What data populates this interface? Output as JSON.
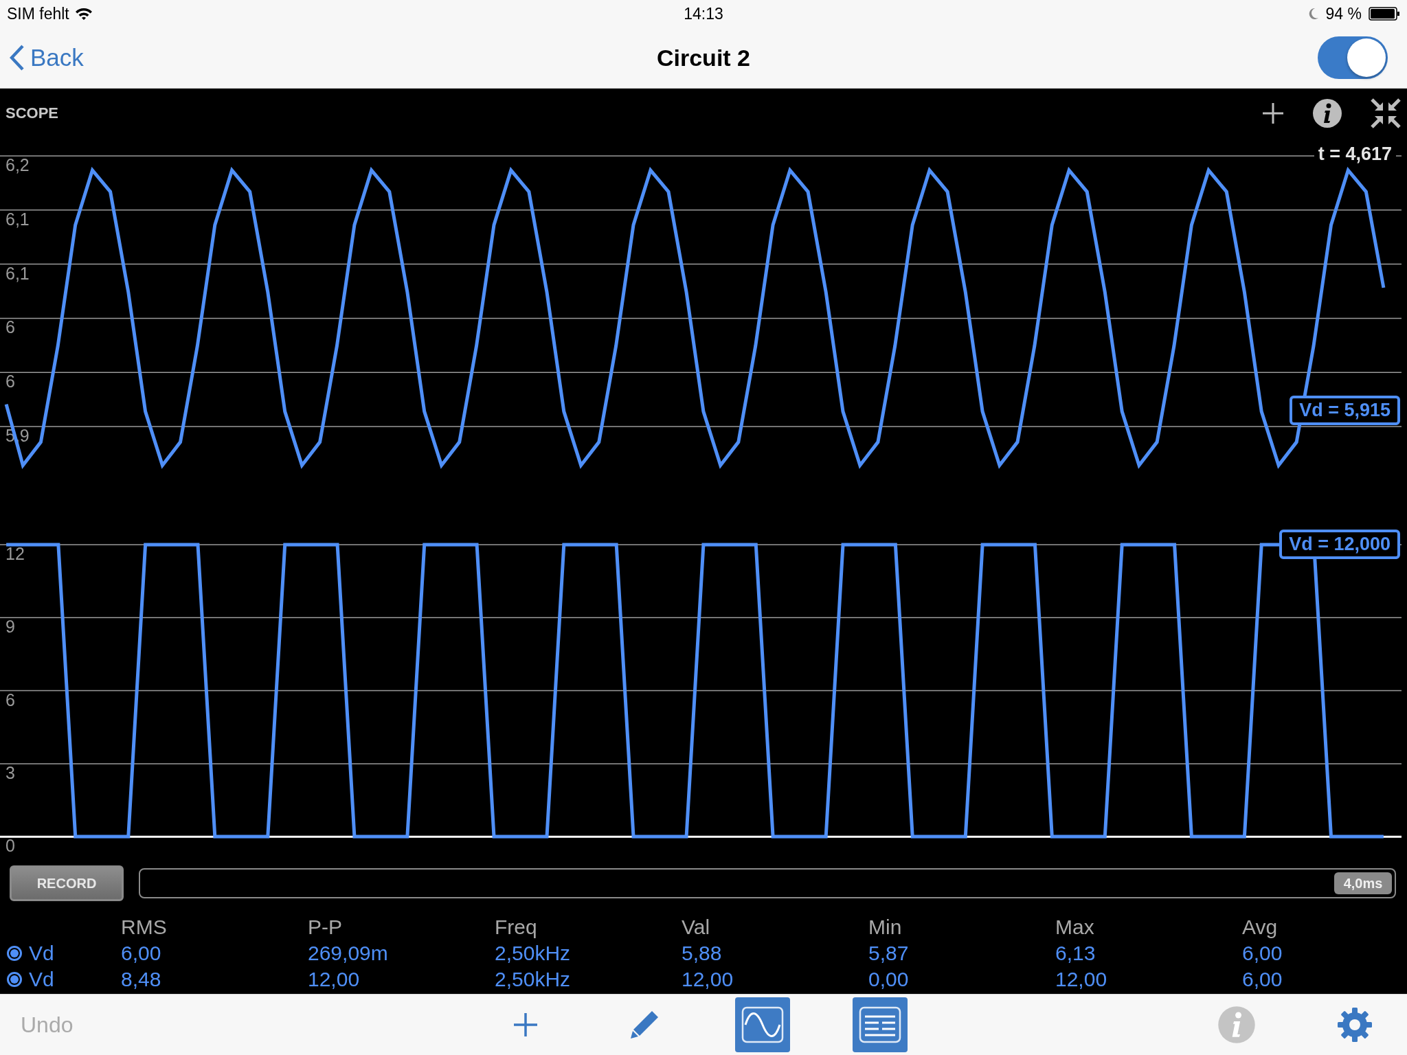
{
  "status_bar": {
    "carrier": "SIM fehlt",
    "time": "14:13",
    "battery": "94 %"
  },
  "nav": {
    "back": "Back",
    "title": "Circuit 2",
    "toggle": {
      "on": true
    }
  },
  "scope": {
    "title": "SCOPE",
    "cursor_time": "t = 4,617",
    "charts": [
      {
        "kind": "sine",
        "y_labels": [
          "6,2",
          "6,1",
          "6,1",
          "6",
          "6",
          "5,9"
        ],
        "readout": "Vd = 5,915"
      },
      {
        "kind": "square",
        "y_labels": [
          "12",
          "9",
          "6",
          "3",
          "0"
        ],
        "readout": "Vd = 12,000"
      }
    ],
    "record": {
      "label": "RECORD",
      "timebase": "4,0ms",
      "level": 1
    },
    "table": {
      "columns": [
        "RMS",
        "P-P",
        "Freq",
        "Val",
        "Min",
        "Max",
        "Avg"
      ],
      "rows": [
        {
          "name": "Vd",
          "selected": true,
          "cells": [
            "6,00",
            "269,09m",
            "2,50kHz",
            "5,88",
            "5,87",
            "6,13",
            "6,00"
          ]
        },
        {
          "name": "Vd",
          "selected": true,
          "cells": [
            "8,48",
            "12,00",
            "2,50kHz",
            "12,00",
            "0,00",
            "12,00",
            "6,00"
          ]
        }
      ]
    }
  },
  "toolbar": {
    "undo": {
      "label": "Undo",
      "disabled": true
    }
  }
}
